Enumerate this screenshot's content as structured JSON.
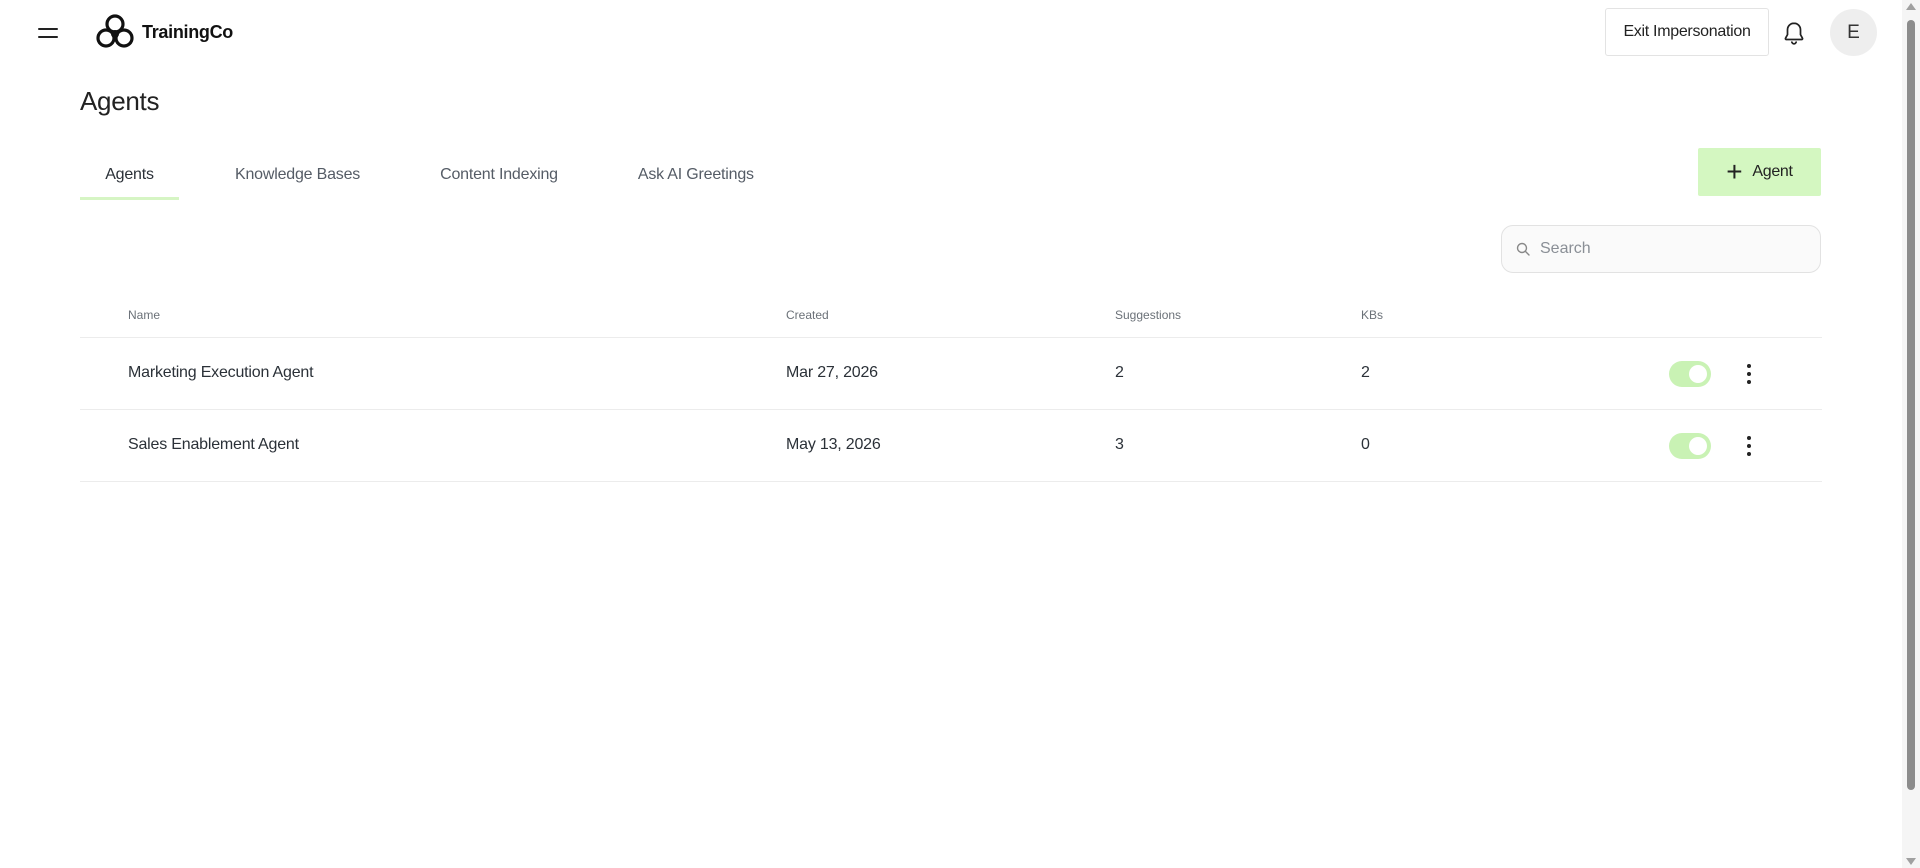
{
  "header": {
    "brand": "TrainingCo",
    "exit_label": "Exit Impersonation",
    "avatar_initial": "E"
  },
  "page": {
    "title": "Agents"
  },
  "tabs": [
    {
      "label": "Agents",
      "active": true
    },
    {
      "label": "Knowledge Bases",
      "active": false
    },
    {
      "label": "Content Indexing",
      "active": false
    },
    {
      "label": "Ask AI Greetings",
      "active": false
    }
  ],
  "actions": {
    "add_label": "Agent"
  },
  "search": {
    "placeholder": "Search",
    "value": ""
  },
  "table": {
    "columns": [
      "Name",
      "Created",
      "Suggestions",
      "KBs"
    ],
    "rows": [
      {
        "name": "Marketing Execution Agent",
        "created": "Mar 27, 2026",
        "suggestions": "2",
        "kbs": "2",
        "enabled": true
      },
      {
        "name": "Sales Enablement Agent",
        "created": "May 13, 2026",
        "suggestions": "3",
        "kbs": "0",
        "enabled": true
      }
    ]
  },
  "colors": {
    "accent": "#d4f7c1",
    "toggle_on": "#c9f2b4",
    "tab_underline": "#d6f5c4"
  },
  "icons": {
    "menu": "menu-icon",
    "logo": "trainingco-logo-icon",
    "bell": "bell-icon",
    "search": "search-icon",
    "plus": "plus-icon",
    "more": "kebab-icon"
  }
}
